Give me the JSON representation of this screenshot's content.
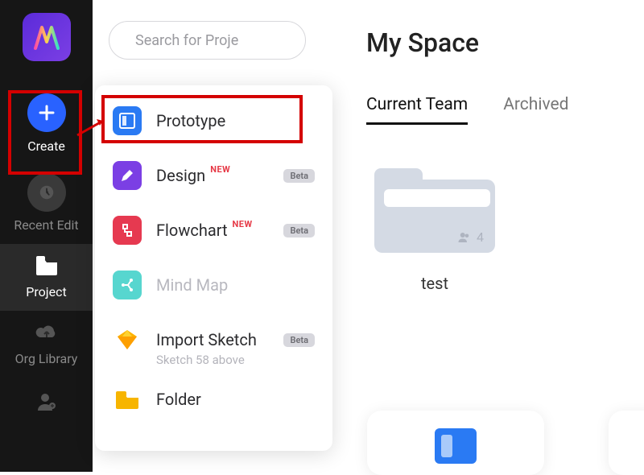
{
  "sidebar": {
    "items": [
      {
        "id": "create",
        "label": "Create"
      },
      {
        "id": "recent-edit",
        "label": "Recent Edit"
      },
      {
        "id": "project",
        "label": "Project"
      },
      {
        "id": "org-library",
        "label": "Org Library"
      }
    ]
  },
  "search": {
    "placeholder": "Search for Proje"
  },
  "create_menu": {
    "items": [
      {
        "id": "prototype",
        "label": "Prototype",
        "icon": "prototype-icon",
        "color": "#2a7af3"
      },
      {
        "id": "design",
        "label": "Design",
        "icon": "design-icon",
        "color": "#7b3fe4",
        "new": "NEW",
        "beta": "Beta"
      },
      {
        "id": "flowchart",
        "label": "Flowchart",
        "icon": "flowchart-icon",
        "color": "#e63950",
        "new": "NEW",
        "beta": "Beta"
      },
      {
        "id": "mindmap",
        "label": "Mind Map",
        "icon": "mindmap-icon",
        "color": "#57d6cf",
        "disabled": true
      },
      {
        "id": "import-sketch",
        "label": "Import Sketch",
        "icon": "sketch-icon",
        "color": "#f7b500",
        "beta": "Beta",
        "sub": "Sketch 58 above"
      },
      {
        "id": "folder",
        "label": "Folder",
        "icon": "folder-icon",
        "color": "#f7b500"
      }
    ]
  },
  "main": {
    "title": "My Space",
    "tabs": [
      {
        "id": "current-team",
        "label": "Current Team",
        "active": true
      },
      {
        "id": "archived",
        "label": "Archived"
      }
    ],
    "folder": {
      "name": "test",
      "members": "4"
    }
  }
}
